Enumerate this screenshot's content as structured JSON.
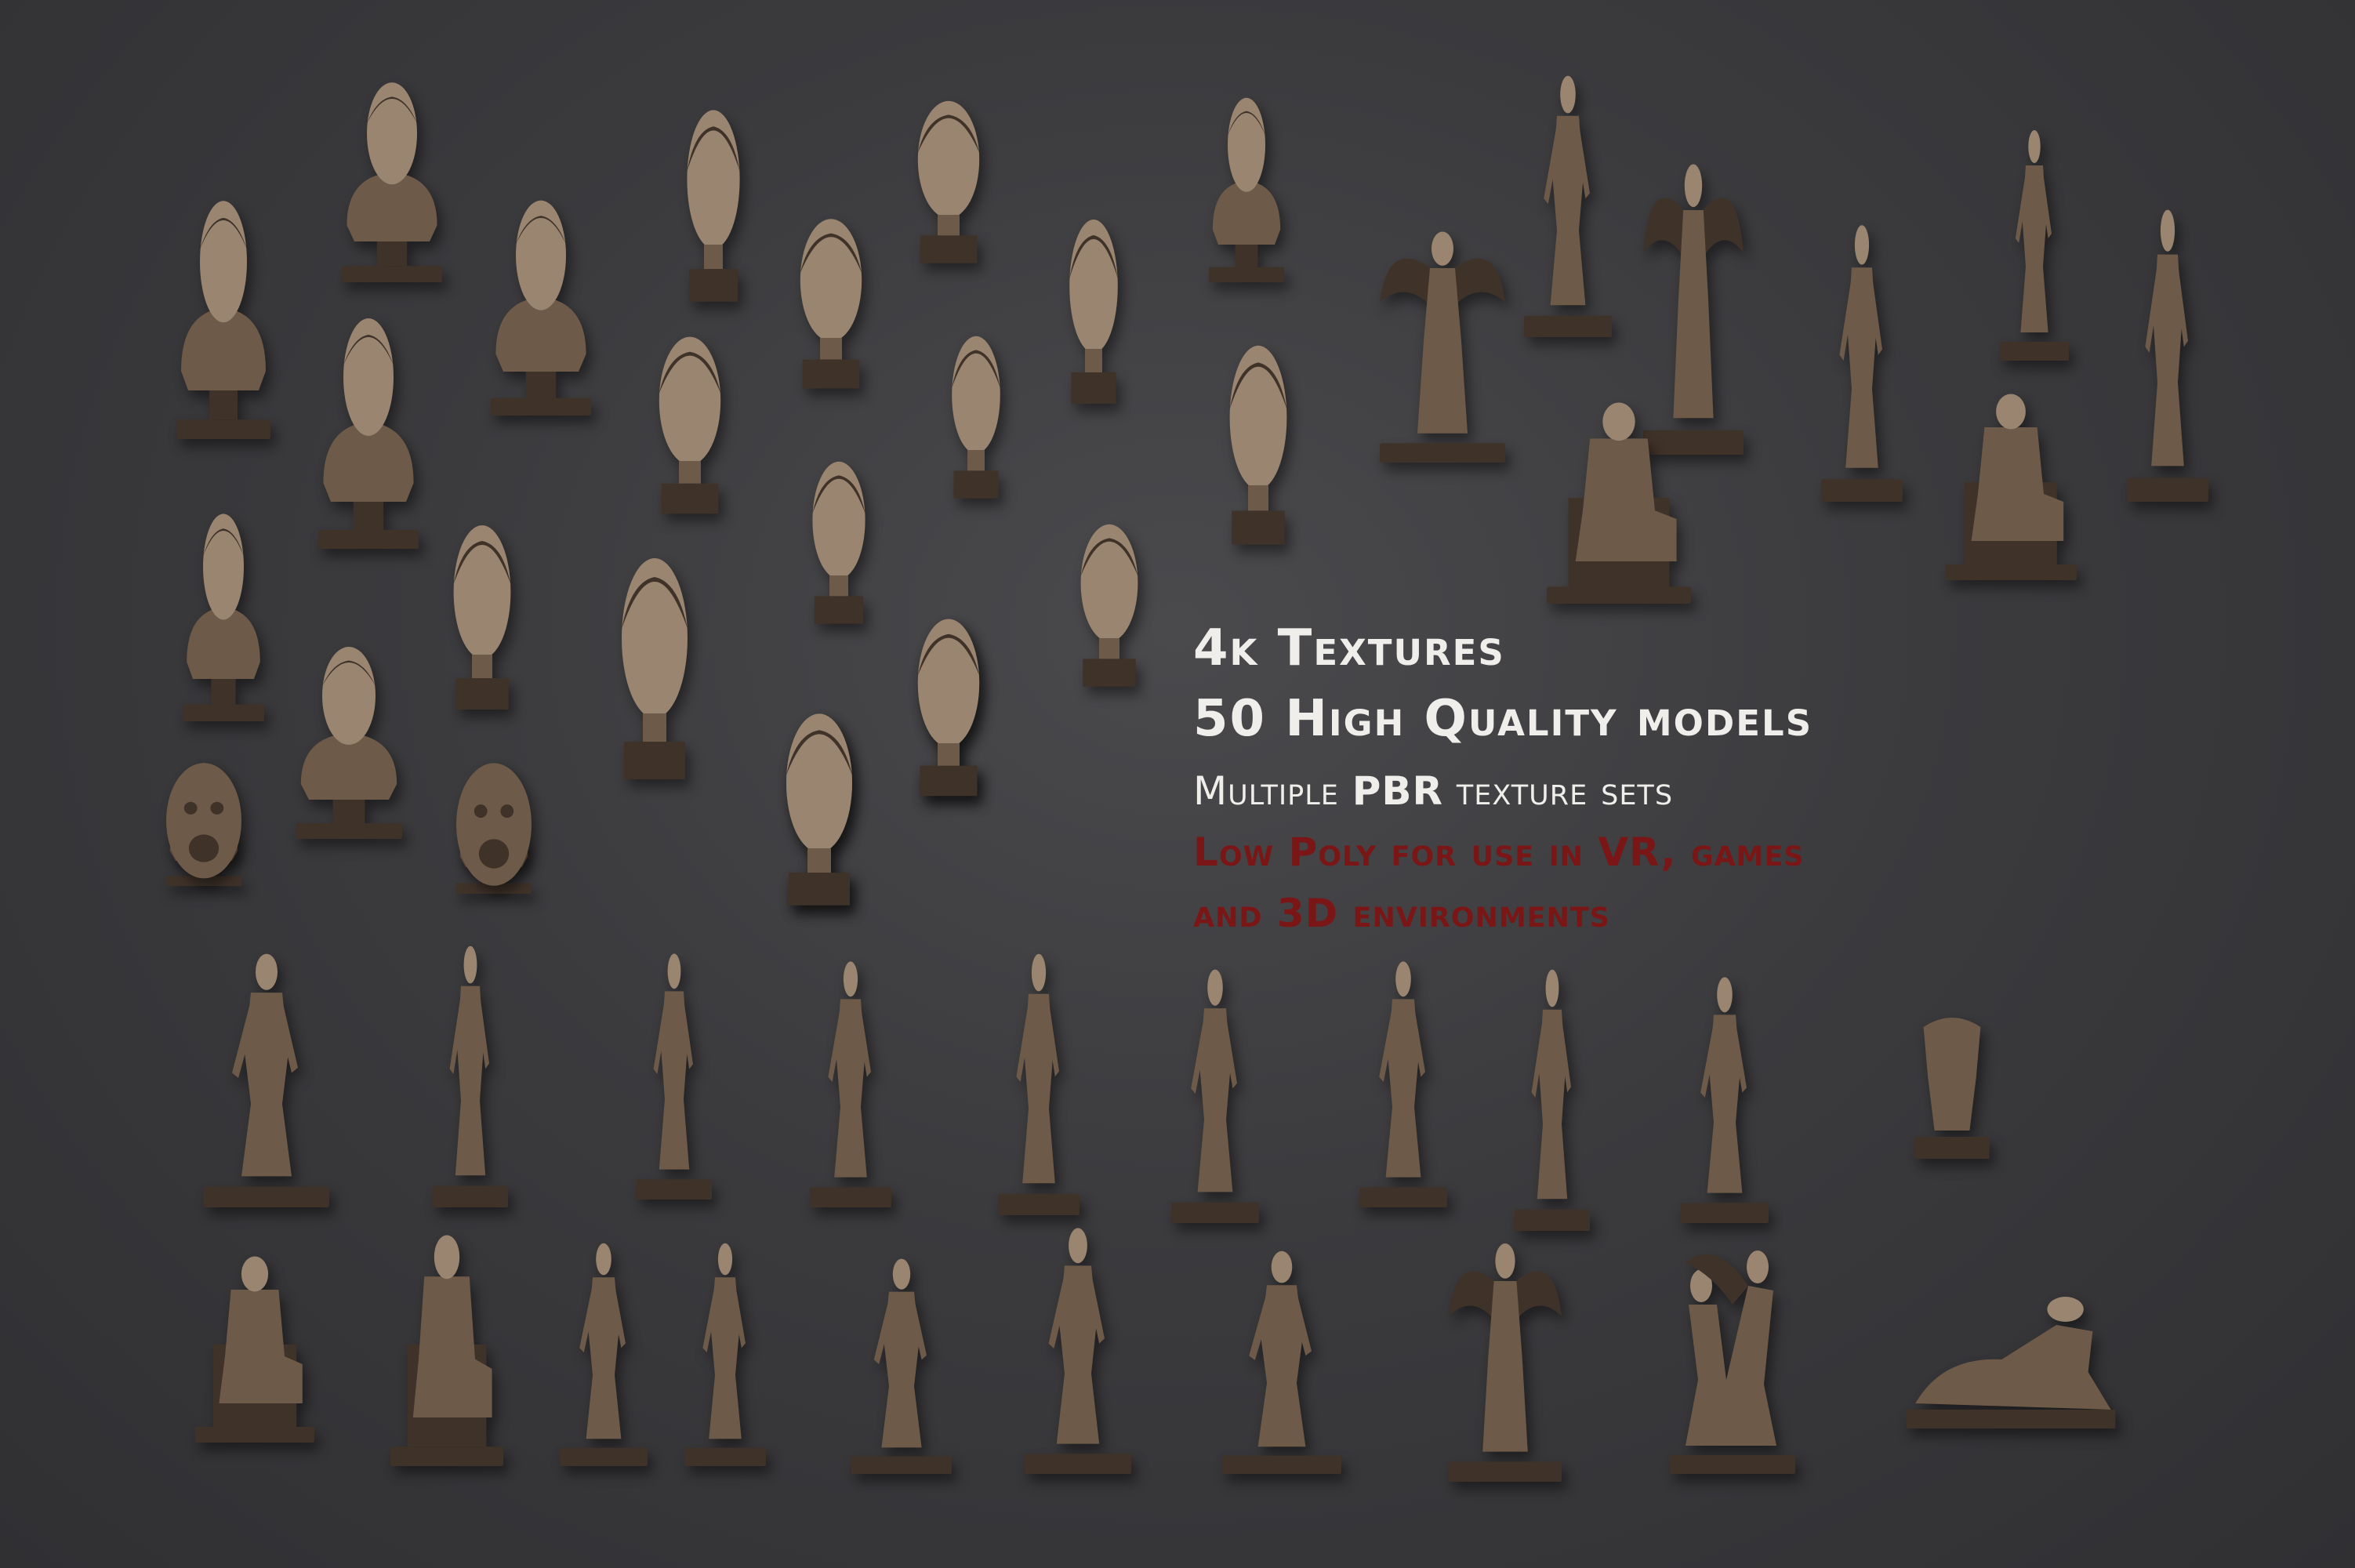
{
  "text": {
    "line1": "4k Textures",
    "line2": "50 High Quality models",
    "line3_pre": "Multiple ",
    "line3_bold": "PBR",
    "line3_post": " texture sets",
    "line4": "Low Poly for use in VR, games",
    "line5": "and 3D environments"
  },
  "colors": {
    "background": "#3b3b3e",
    "bronze": "#6e5a48",
    "bronze_light": "#9a8570",
    "bronze_dark": "#3f3229",
    "headline_text": "#f0eeea",
    "accent_red": "#7a1616"
  },
  "statues": [
    {
      "kind": "bust"
    },
    {
      "kind": "bust"
    },
    {
      "kind": "bust"
    },
    {
      "kind": "head"
    },
    {
      "kind": "head"
    },
    {
      "kind": "head"
    },
    {
      "kind": "head"
    },
    {
      "kind": "head"
    },
    {
      "kind": "head"
    },
    {
      "kind": "bust"
    },
    {
      "kind": "bust"
    },
    {
      "kind": "head"
    },
    {
      "kind": "head"
    },
    {
      "kind": "head"
    },
    {
      "kind": "bust"
    },
    {
      "kind": "head"
    },
    {
      "kind": "head"
    },
    {
      "kind": "head"
    },
    {
      "kind": "bust"
    },
    {
      "kind": "bust"
    },
    {
      "kind": "bust"
    },
    {
      "kind": "head"
    },
    {
      "kind": "mask"
    },
    {
      "kind": "mask"
    },
    {
      "kind": "head"
    },
    {
      "kind": "head"
    },
    {
      "kind": "winged"
    },
    {
      "kind": "figure"
    },
    {
      "kind": "winged"
    },
    {
      "kind": "seated"
    },
    {
      "kind": "figure"
    },
    {
      "kind": "figure"
    },
    {
      "kind": "seated"
    },
    {
      "kind": "figure"
    },
    {
      "kind": "figure"
    },
    {
      "kind": "figure"
    },
    {
      "kind": "figure"
    },
    {
      "kind": "figure"
    },
    {
      "kind": "figure"
    },
    {
      "kind": "figure"
    },
    {
      "kind": "figure"
    },
    {
      "kind": "figure"
    },
    {
      "kind": "figure"
    },
    {
      "kind": "torso"
    },
    {
      "kind": "seated"
    },
    {
      "kind": "seated"
    },
    {
      "kind": "figure"
    },
    {
      "kind": "figure"
    },
    {
      "kind": "figure"
    },
    {
      "kind": "figure"
    },
    {
      "kind": "figure"
    },
    {
      "kind": "winged"
    },
    {
      "kind": "group"
    },
    {
      "kind": "reclining"
    }
  ]
}
